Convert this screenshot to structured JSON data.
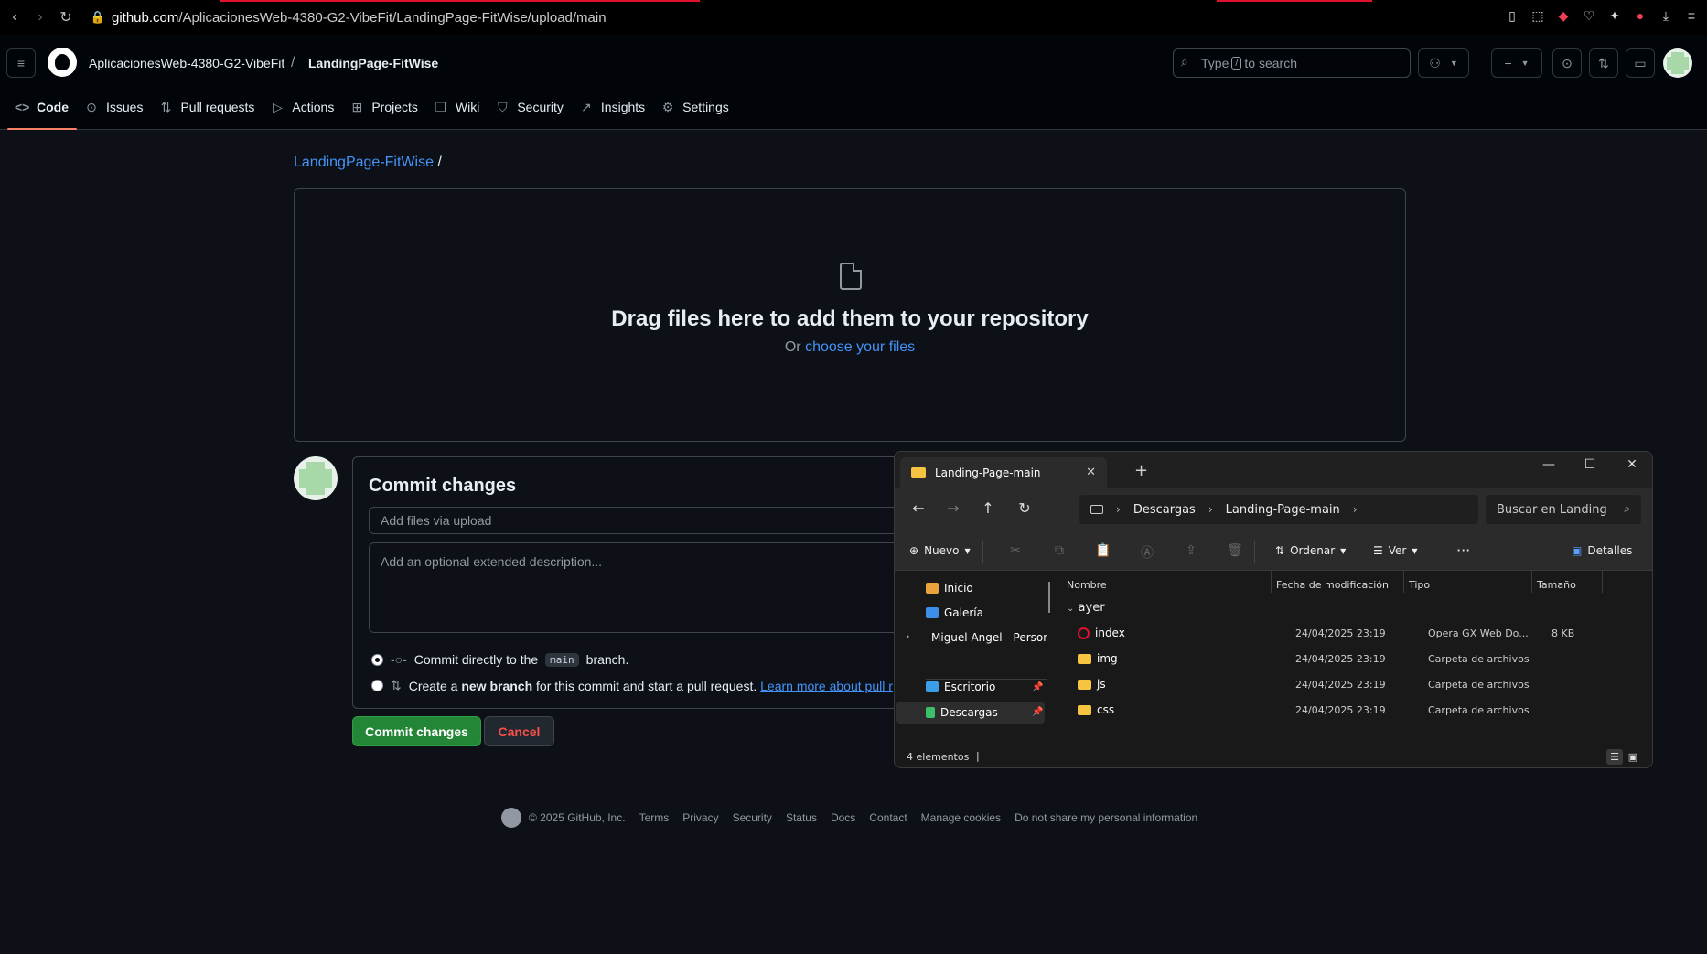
{
  "browser": {
    "url_host": "github.com",
    "url_path": "/AplicacionesWeb-4380-G2-VibeFit/LandingPage-FitWise/upload/main"
  },
  "header": {
    "owner": "AplicacionesWeb-4380-G2-VibeFit",
    "repo": "LandingPage-FitWise",
    "search_before": "Type",
    "search_key": "/",
    "search_after": "to search"
  },
  "tabs": [
    {
      "label": "Code",
      "icon": "code-icon"
    },
    {
      "label": "Issues",
      "icon": "issue-icon"
    },
    {
      "label": "Pull requests",
      "icon": "pull-request-icon"
    },
    {
      "label": "Actions",
      "icon": "play-icon"
    },
    {
      "label": "Projects",
      "icon": "table-icon"
    },
    {
      "label": "Wiki",
      "icon": "book-icon"
    },
    {
      "label": "Security",
      "icon": "shield-icon"
    },
    {
      "label": "Insights",
      "icon": "graph-icon"
    },
    {
      "label": "Settings",
      "icon": "gear-icon"
    }
  ],
  "main": {
    "breadcrumb_repo": "LandingPage-FitWise",
    "breadcrumb_sep": "/",
    "drop_title": "Drag files here to add them to your repository",
    "drop_or": "Or",
    "drop_link": "choose your files"
  },
  "commit": {
    "title": "Commit changes",
    "summary_placeholder": "Add files via upload",
    "desc_placeholder": "Add an optional extended description...",
    "option1_pre": "Commit directly to the",
    "option1_branch": "main",
    "option1_post": "branch.",
    "option2_pre": "Create a",
    "option2_bold": "new branch",
    "option2_post": "for this commit and start a pull request.",
    "option2_link": "Learn more about pull r",
    "commit_button": "Commit changes",
    "cancel_button": "Cancel"
  },
  "footer": {
    "copyright": "© 2025 GitHub, Inc.",
    "links": [
      "Terms",
      "Privacy",
      "Security",
      "Status",
      "Docs",
      "Contact",
      "Manage cookies",
      "Do not share my personal information"
    ]
  },
  "explorer": {
    "tab_title": "Landing-Page-main",
    "path": [
      "Descargas",
      "Landing-Page-main"
    ],
    "search_placeholder": "Buscar en Landing",
    "toolbar": {
      "new": "Nuevo",
      "sort": "Ordenar",
      "view": "Ver",
      "more": "···",
      "details": "Detalles"
    },
    "sidebar": [
      {
        "label": "Inicio",
        "color": "#e8a33d"
      },
      {
        "label": "Galería",
        "color": "#3d8ee8"
      },
      {
        "label": "Miguel Angel - Personal",
        "color": "#3d8ee8"
      },
      {
        "label": "Escritorio",
        "color": "#3d9ee8"
      },
      {
        "label": "Descargas",
        "color": "#3dbf6a"
      }
    ],
    "columns": [
      "Nombre",
      "Fecha de modificación",
      "Tipo",
      "Tamaño"
    ],
    "group": "ayer",
    "rows": [
      {
        "name": "index",
        "date": "24/04/2025 23:19",
        "type": "Opera GX Web Do...",
        "size": "8 KB"
      },
      {
        "name": "img",
        "date": "24/04/2025 23:19",
        "type": "Carpeta de archivos",
        "size": ""
      },
      {
        "name": "js",
        "date": "24/04/2025 23:19",
        "type": "Carpeta de archivos",
        "size": ""
      },
      {
        "name": "css",
        "date": "24/04/2025 23:19",
        "type": "Carpeta de archivos",
        "size": ""
      }
    ],
    "status": "4 elementos",
    "status_sep": "|"
  }
}
